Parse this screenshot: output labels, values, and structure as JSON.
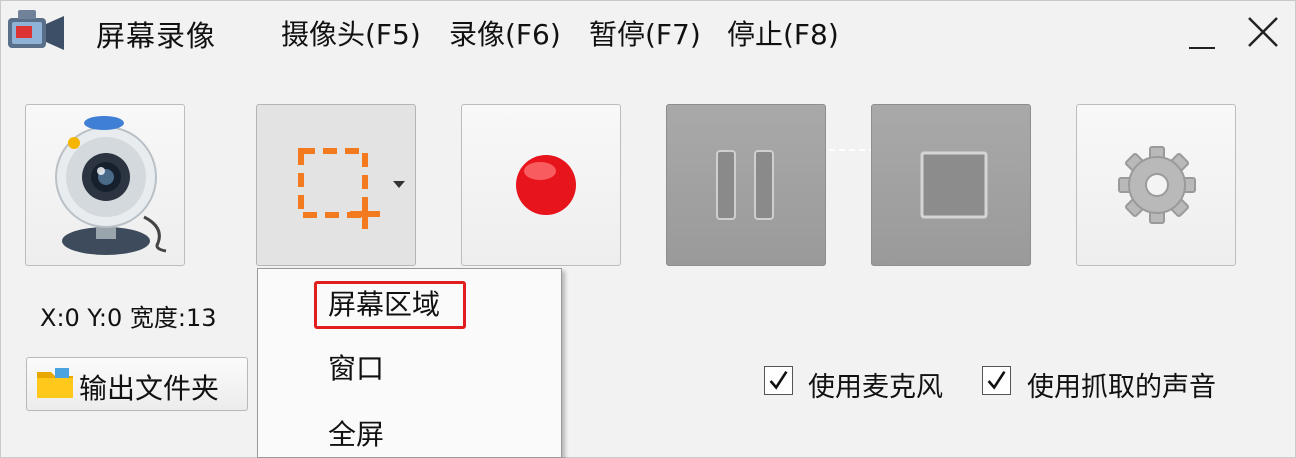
{
  "title": "屏幕录像",
  "menu": [
    {
      "label": "摄像头(F5)"
    },
    {
      "label": "录像(F6)"
    },
    {
      "label": "暂停(F7)"
    },
    {
      "label": "停止(F8)"
    }
  ],
  "window_controls": {
    "minimize": "_",
    "close": "X"
  },
  "toolbar": {
    "camera": {
      "icon": "webcam-icon"
    },
    "region": {
      "icon": "region-select-icon",
      "dropdown_arrow": "chevron-down-icon"
    },
    "record": {
      "icon": "record-icon"
    },
    "pause": {
      "icon": "pause-icon",
      "state": "disabled"
    },
    "stop": {
      "icon": "stop-icon",
      "state": "disabled"
    },
    "settings": {
      "icon": "gear-icon"
    }
  },
  "status": {
    "coords": "X:0 Y:0 宽度:13"
  },
  "output_folder": {
    "label": "输出文件夹",
    "icon": "folder-icon"
  },
  "options": {
    "mic": {
      "label": "使用麦克风",
      "checked": true
    },
    "capture_sound": {
      "label": "使用抓取的声音",
      "checked": true
    }
  },
  "dropdown": {
    "items": [
      {
        "label": "屏幕区域",
        "highlighted": true
      },
      {
        "label": "窗口"
      },
      {
        "label": "全屏"
      }
    ]
  },
  "colors": {
    "accent_orange": "#f47a20",
    "record_red": "#e8141c",
    "highlight_red": "#e01e1e"
  }
}
